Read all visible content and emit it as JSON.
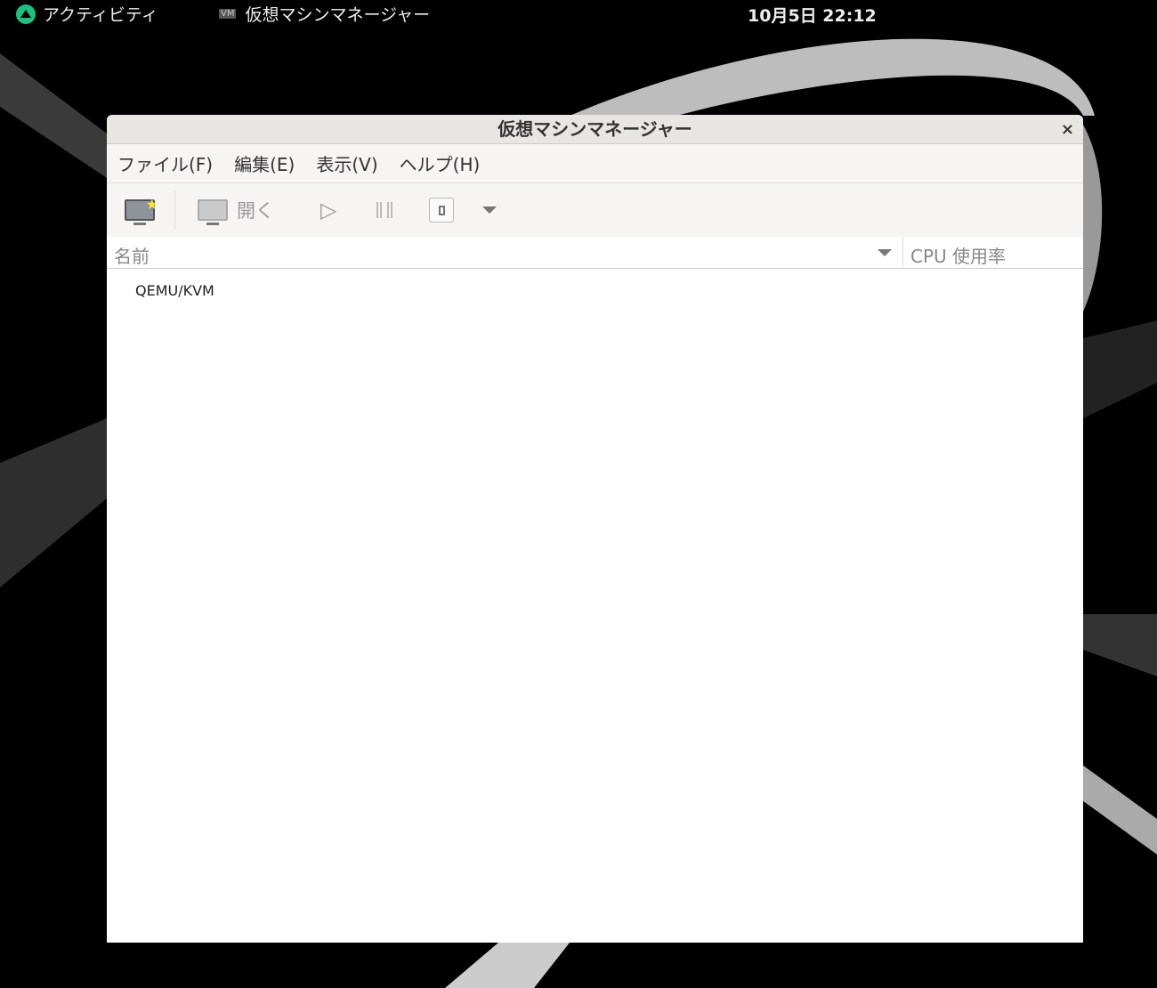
{
  "topbar": {
    "activities": "アクティビティ",
    "app_name": "仮想マシンマネージャー",
    "app_icon_text": "VM",
    "clock": "10月5日 22:12"
  },
  "window": {
    "title": "仮想マシンマネージャー",
    "close": "×"
  },
  "menu": [
    "ファイル(F)",
    "編集(E)",
    "表示(V)",
    "ヘルプ(H)"
  ],
  "toolbar": {
    "open_label": "開く"
  },
  "columns": {
    "name": "名前",
    "cpu": "CPU 使用率"
  },
  "connections": [
    "QEMU/KVM"
  ]
}
